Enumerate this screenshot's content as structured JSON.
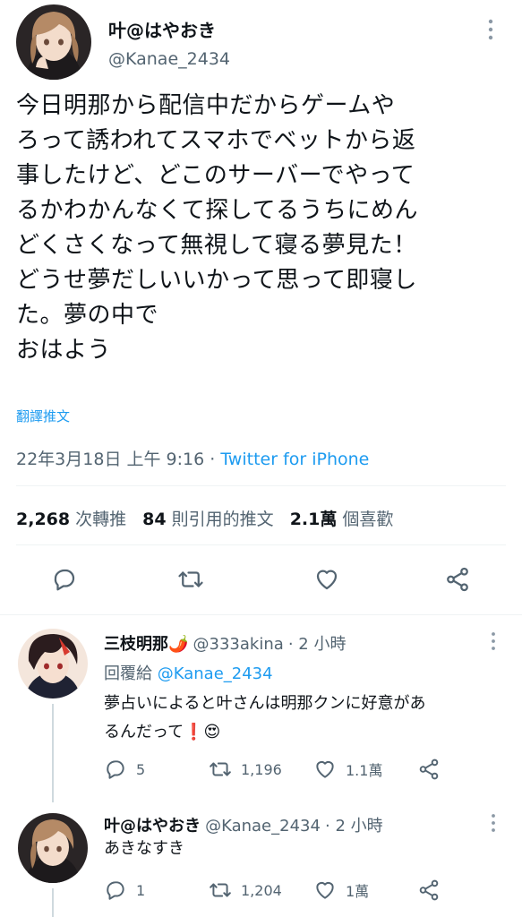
{
  "main_tweet": {
    "author_name": "叶@はやおき",
    "author_handle": "@Kanae_2434",
    "text": "今日明那から配信中だからゲームや\nろって誘われてスマホでベットから返\n事したけど、どこのサーバーでやって\nるかわかんなくて探してるうちにめん\nどくさくなって無視して寝る夢見た！\nどうせ夢だしいいかって思って即寝し\nた。夢の中で\nおはよう",
    "translate_label": "翻譯推文",
    "timestamp": "22年3月18日 上午 9:16",
    "separator": "·",
    "source": "Twitter for iPhone",
    "stats": {
      "retweets_count": "2,268",
      "retweets_label": "次轉推",
      "quotes_count": "84",
      "quotes_label": "則引用的推文",
      "likes_count": "2.1萬",
      "likes_label": "個喜歡"
    },
    "actions": [
      "reply-icon",
      "retweet-icon",
      "like-icon",
      "share-icon"
    ]
  },
  "replies": [
    {
      "author_name": "三枝明那🌶️",
      "author_handle": "@333akina",
      "time": "· 2 小時",
      "reply_to_label": "回覆給",
      "reply_to_handle": "@Kanae_2434",
      "text": "夢占いによると叶さんは明那クンに好意があ\nるんだって❗😍",
      "reply_count": "5",
      "retweet_count": "1,196",
      "like_count": "1.1萬"
    },
    {
      "author_name": "叶@はやおき",
      "author_handle": "@Kanae_2434",
      "time": "· 2 小時",
      "text": "あきなすき",
      "reply_count": "1",
      "retweet_count": "1,204",
      "like_count": "1萬"
    }
  ],
  "colors": {
    "text": "#0f1419",
    "secondary": "#536471",
    "link": "#1d9bf0",
    "divider": "#eff3f4"
  }
}
